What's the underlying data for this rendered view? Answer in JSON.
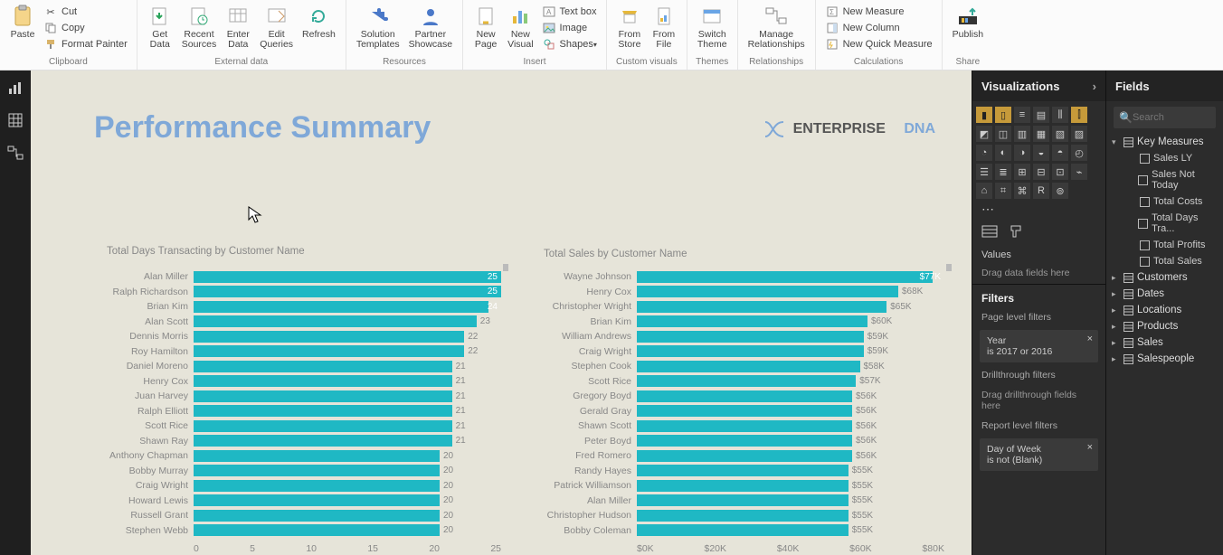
{
  "ribbon": {
    "paste": "Paste",
    "cut": "Cut",
    "copy": "Copy",
    "format_painter": "Format Painter",
    "clipboard_group": "Clipboard",
    "get_data": "Get\nData",
    "recent_sources": "Recent\nSources",
    "enter_data": "Enter\nData",
    "edit_queries": "Edit\nQueries",
    "refresh": "Refresh",
    "external_group": "External data",
    "solution_templates": "Solution\nTemplates",
    "partner_showcase": "Partner\nShowcase",
    "resources_group": "Resources",
    "new_page": "New\nPage",
    "new_visual": "New\nVisual",
    "text_box": "Text box",
    "image": "Image",
    "shapes": "Shapes",
    "insert_group": "Insert",
    "from_store": "From\nStore",
    "from_file": "From\nFile",
    "custom_visuals_group": "Custom visuals",
    "switch_theme": "Switch\nTheme",
    "themes_group": "Themes",
    "manage_relationships": "Manage\nRelationships",
    "relationships_group": "Relationships",
    "new_measure": "New Measure",
    "new_column": "New Column",
    "new_quick_measure": "New Quick Measure",
    "calculations_group": "Calculations",
    "publish": "Publish",
    "share_group": "Share"
  },
  "canvas": {
    "title": "Performance Summary",
    "logo_a": "ENTERPRISE",
    "logo_b": "DNA"
  },
  "chart_data": [
    {
      "type": "bar",
      "title": "Total Days Transacting by Customer Name",
      "orientation": "horizontal",
      "xlim": [
        0,
        25
      ],
      "xticks": [
        "0",
        "5",
        "10",
        "15",
        "20",
        "25"
      ],
      "categories": [
        "Alan Miller",
        "Ralph Richardson",
        "Brian Kim",
        "Alan Scott",
        "Dennis Morris",
        "Roy Hamilton",
        "Daniel Moreno",
        "Henry Cox",
        "Juan Harvey",
        "Ralph Elliott",
        "Scott Rice",
        "Shawn Ray",
        "Anthony Chapman",
        "Bobby Murray",
        "Craig Wright",
        "Howard Lewis",
        "Russell Grant",
        "Stephen Webb"
      ],
      "values": [
        25,
        25,
        24,
        23,
        22,
        22,
        21,
        21,
        21,
        21,
        21,
        21,
        20,
        20,
        20,
        20,
        20,
        20
      ],
      "highlight_count": 3
    },
    {
      "type": "bar",
      "title": "Total Sales by Customer Name",
      "orientation": "horizontal",
      "xlim": [
        0,
        80000
      ],
      "xticks": [
        "$0K",
        "$20K",
        "$40K",
        "$60K",
        "$80K"
      ],
      "categories": [
        "Wayne Johnson",
        "Henry Cox",
        "Christopher Wright",
        "Brian Kim",
        "William Andrews",
        "Craig Wright",
        "Stephen Cook",
        "Scott Rice",
        "Gregory Boyd",
        "Gerald Gray",
        "Shawn Scott",
        "Peter Boyd",
        "Fred Romero",
        "Randy Hayes",
        "Patrick Williamson",
        "Alan Miller",
        "Christopher Hudson",
        "Bobby Coleman"
      ],
      "values": [
        77000,
        68000,
        65000,
        60000,
        59000,
        59000,
        58000,
        57000,
        56000,
        56000,
        56000,
        56000,
        56000,
        55000,
        55000,
        55000,
        55000,
        55000
      ],
      "value_labels": [
        "$77K",
        "$68K",
        "$65K",
        "$60K",
        "$59K",
        "$59K",
        "$58K",
        "$57K",
        "$56K",
        "$56K",
        "$56K",
        "$56K",
        "$56K",
        "$55K",
        "$55K",
        "$55K",
        "$55K",
        "$55K"
      ],
      "highlight_count": 1
    }
  ],
  "vis_pane": {
    "header": "Visualizations",
    "values_label": "Values",
    "values_drop": "Drag data fields here",
    "filters_header": "Filters",
    "page_filters": "Page level filters",
    "filter_year_name": "Year",
    "filter_year_val": "is 2017 or 2016",
    "drill_header": "Drillthrough filters",
    "drill_drop": "Drag drillthrough fields here",
    "report_filters": "Report level filters",
    "filter_dow_name": "Day of Week",
    "filter_dow_val": "is not (Blank)"
  },
  "fields_pane": {
    "header": "Fields",
    "search_placeholder": "Search",
    "key_measures": "Key Measures",
    "measures": [
      "Sales LY",
      "Sales Not Today",
      "Total Costs",
      "Total Days Tra...",
      "Total Profits",
      "Total Sales"
    ],
    "tables": [
      "Customers",
      "Dates",
      "Locations",
      "Products",
      "Sales",
      "Salespeople"
    ]
  }
}
